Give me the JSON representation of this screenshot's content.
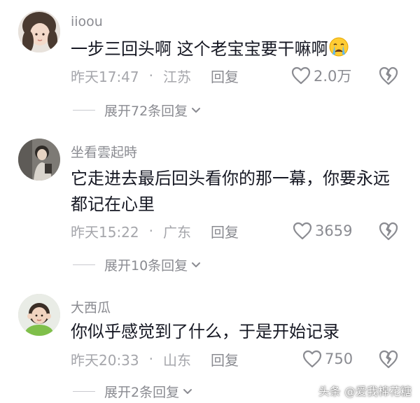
{
  "comments": [
    {
      "username": "iioou",
      "text": "一步三回头啊 这个老宝宝要干嘛啊",
      "emoji": "crying-face",
      "time": "昨天17:47",
      "separator": "·",
      "location": "江苏",
      "reply_label": "回复",
      "likes": "2.0万",
      "expand_label": "展开72条回复"
    },
    {
      "username": "坐看雲起時",
      "text": "它走进去最后回头看你的那一幕，你要永远都记在心里",
      "time": "昨天15:22",
      "separator": "·",
      "location": "广东",
      "reply_label": "回复",
      "likes": "3659",
      "expand_label": "展开10条回复"
    },
    {
      "username": "大西瓜",
      "text": "你似乎感觉到了什么，于是开始记录",
      "time": "昨天20:33",
      "separator": "·",
      "location": "山东",
      "reply_label": "回复",
      "likes": "750",
      "expand_label": "展开2条回复"
    }
  ],
  "watermark": "头条 @爱我棉花糖",
  "icons": {
    "like": "heart-outline-icon",
    "dislike": "broken-heart-icon",
    "expand": "chevron-down-icon"
  },
  "colors": {
    "primary_text": "#161823",
    "secondary_text": "#8a8b91",
    "meta_text": "#a5a6ab"
  }
}
